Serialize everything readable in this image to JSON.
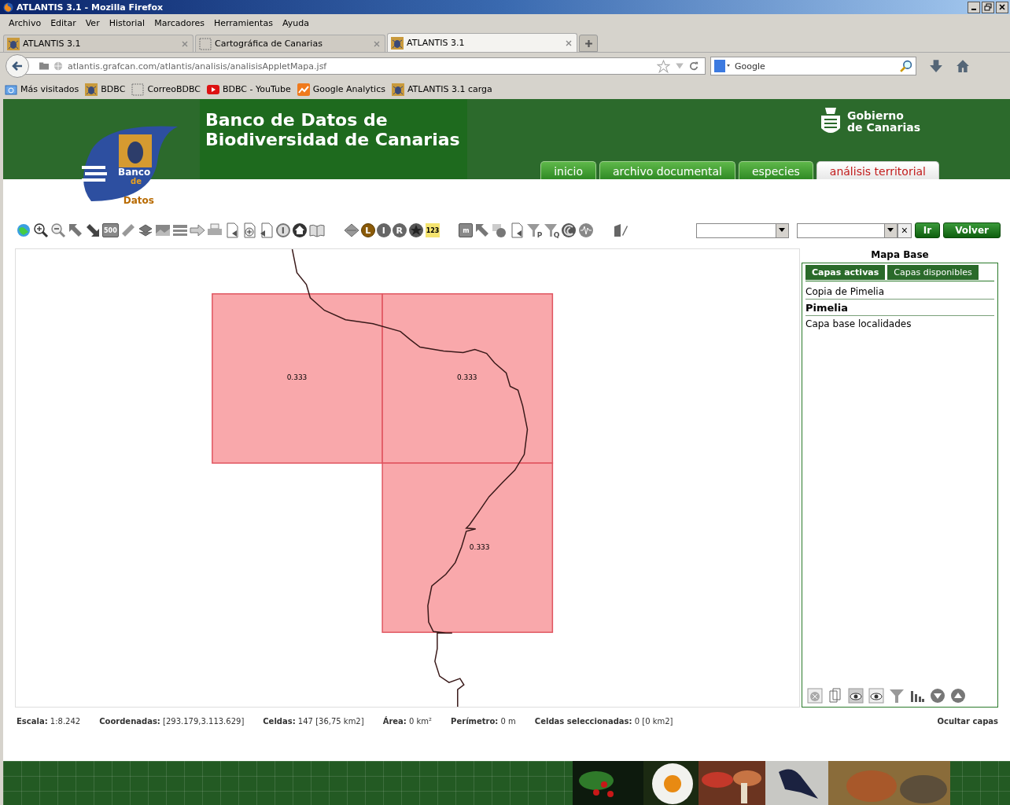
{
  "window": {
    "title": "ATLANTIS 3.1 - Mozilla Firefox"
  },
  "menu": [
    "Archivo",
    "Editar",
    "Ver",
    "Historial",
    "Marcadores",
    "Herramientas",
    "Ayuda"
  ],
  "tabs": [
    {
      "label": "ATLANTIS 3.1",
      "selected": false,
      "kind": "site"
    },
    {
      "label": "Cartográfica de Canarias",
      "selected": false,
      "kind": "blank"
    },
    {
      "label": "ATLANTIS 3.1",
      "selected": true,
      "kind": "site"
    }
  ],
  "address": {
    "url": "atlantis.grafcan.com/atlantis/analisis/analisisAppletMapa.jsf"
  },
  "search": {
    "placeholder": "Google"
  },
  "bookmarks": [
    {
      "label": "Más visitados",
      "kind": "folder"
    },
    {
      "label": "BDBC",
      "kind": "site"
    },
    {
      "label": "CorreoBDBC",
      "kind": "blank"
    },
    {
      "label": "BDBC - YouTube",
      "kind": "youtube"
    },
    {
      "label": "Google Analytics",
      "kind": "analytics"
    },
    {
      "label": "ATLANTIS 3.1 carga",
      "kind": "site"
    }
  ],
  "header": {
    "title_lines": [
      "Banco de Datos de",
      "Biodiversidad de Canarias"
    ],
    "logo_lines": [
      "Banco",
      "de",
      "Datos"
    ],
    "gov_lines": [
      "Gobierno",
      "de Canarias"
    ]
  },
  "nav": [
    {
      "label": "inicio",
      "selected": false
    },
    {
      "label": "archivo documental",
      "selected": false
    },
    {
      "label": "especies",
      "selected": false
    },
    {
      "label": "análisis territorial",
      "selected": true
    }
  ],
  "toolbar_badges": [
    "500",
    "I",
    "L",
    "I",
    "R",
    "123",
    "m",
    "P",
    "Q"
  ],
  "controls": {
    "clear": "×",
    "go": "Ir",
    "back": "Volver"
  },
  "map": {
    "cells": [
      {
        "label": "0.333"
      },
      {
        "label": "0.333"
      },
      {
        "label": "0.333"
      }
    ]
  },
  "panel": {
    "title": "Mapa Base",
    "tabs": [
      {
        "label": "Capas activas",
        "selected": true
      },
      {
        "label": "Capas disponibles",
        "selected": false
      }
    ],
    "layers": [
      {
        "name": "Copia de Pimelia",
        "selected": false
      },
      {
        "name": "Pimelia",
        "selected": true
      },
      {
        "name": "Capa base localidades",
        "selected": false
      }
    ]
  },
  "status": [
    {
      "label": "Escala:",
      "value": "1:8.242"
    },
    {
      "label": "Coordenadas:",
      "value": "[293.179,3.113.629]"
    },
    {
      "label": "Celdas:",
      "value": "147 [36,75 km2]"
    },
    {
      "label": "Área:",
      "value": "0 km²"
    },
    {
      "label": "Perímetro:",
      "value": "0 m"
    },
    {
      "label": "Celdas seleccionadas:",
      "value": "0 [0 km2]"
    }
  ],
  "hide_layers": "Ocultar capas"
}
